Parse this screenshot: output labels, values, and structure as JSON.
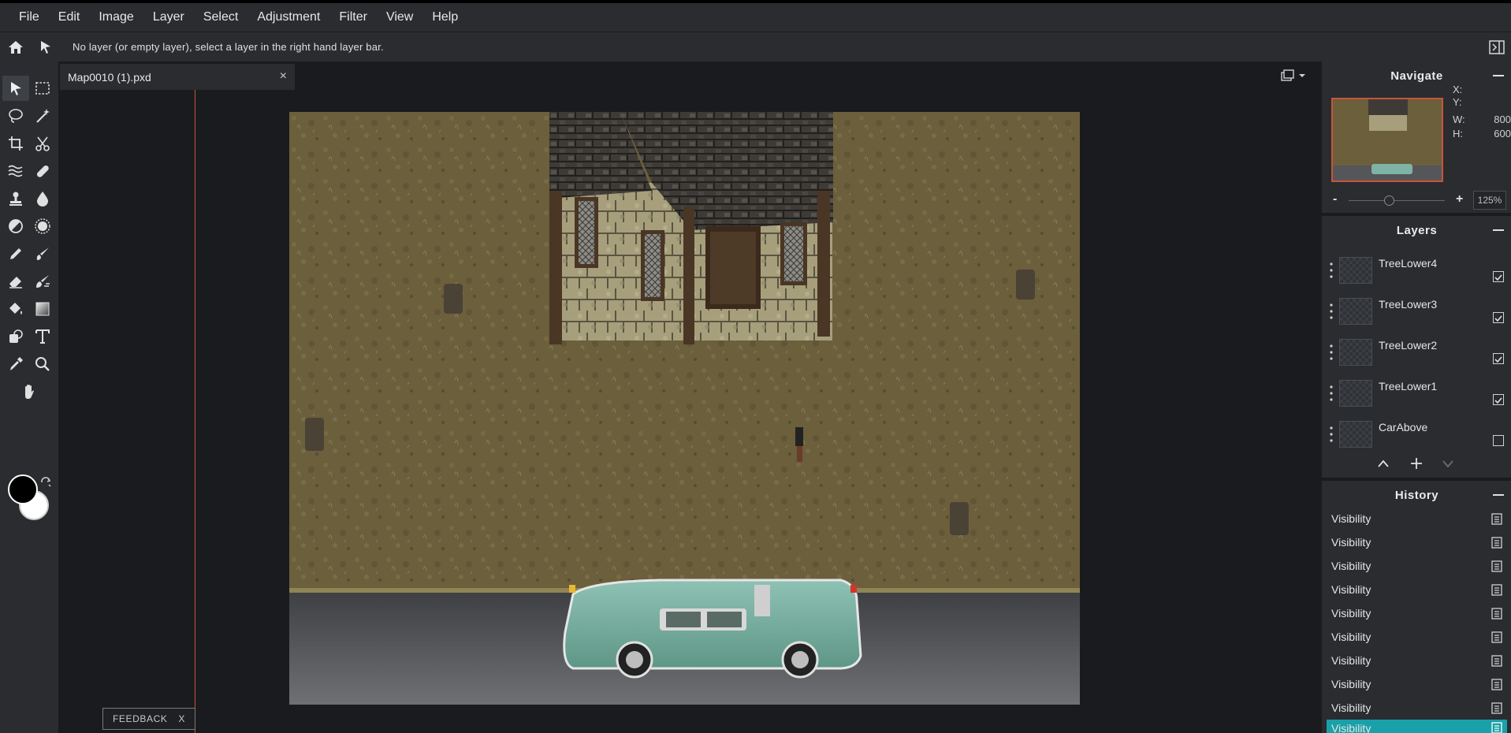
{
  "menu": [
    "File",
    "Edit",
    "Image",
    "Layer",
    "Select",
    "Adjustment",
    "Filter",
    "View",
    "Help"
  ],
  "options": {
    "message": "No layer (or empty layer), select a layer in the right hand layer bar."
  },
  "document": {
    "tab_name": "Map0010 (1).pxd",
    "close_glyph": "×"
  },
  "feedback": {
    "label": "FEEDBACK",
    "close": "X"
  },
  "navigate": {
    "title": "Navigate",
    "x_label": "X:",
    "y_label": "Y:",
    "w_label": "W:",
    "w_value": "800",
    "h_label": "H:",
    "h_value": "600",
    "zoom_minus": "-",
    "zoom_plus": "+",
    "zoom_value": "125%",
    "zoom_level_fraction": 0.42
  },
  "layers": {
    "title": "Layers",
    "items": [
      {
        "name": "TreeLower4",
        "visible": true
      },
      {
        "name": "TreeLower3",
        "visible": true
      },
      {
        "name": "TreeLower2",
        "visible": true
      },
      {
        "name": "TreeLower1",
        "visible": true
      },
      {
        "name": "CarAbove",
        "visible": false
      }
    ]
  },
  "history": {
    "title": "History",
    "items": [
      "Visibility",
      "Visibility",
      "Visibility",
      "Visibility",
      "Visibility",
      "Visibility",
      "Visibility",
      "Visibility",
      "Visibility",
      "Visibility"
    ],
    "current_index": 9
  },
  "colors": {
    "accent": "#1aa0a8",
    "guide": "#c8553a",
    "foreground": "#000000",
    "background": "#ffffff"
  }
}
